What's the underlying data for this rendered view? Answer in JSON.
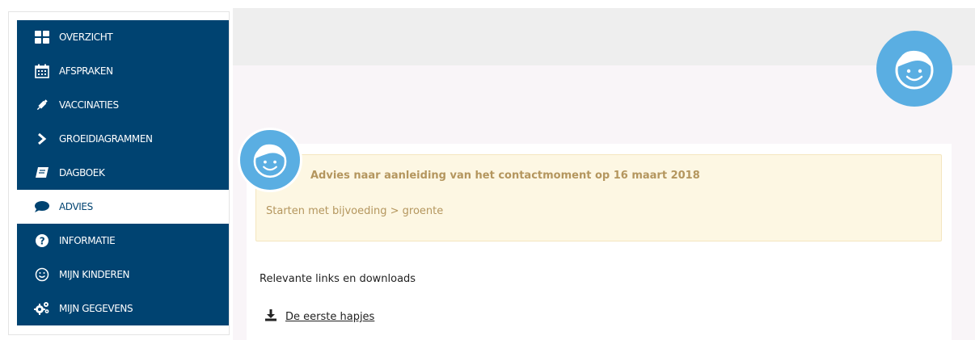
{
  "sidebar": {
    "items": [
      {
        "label": "OVERZICHT",
        "icon": "dashboard-icon",
        "active": false
      },
      {
        "label": "AFSPRAKEN",
        "icon": "calendar-icon",
        "active": false
      },
      {
        "label": "VACCINATIES",
        "icon": "syringe-icon",
        "active": false
      },
      {
        "label": "GROEIDIAGRAMMEN",
        "icon": "chevron-right-icon",
        "active": false
      },
      {
        "label": "DAGBOEK",
        "icon": "book-icon",
        "active": false
      },
      {
        "label": "ADVIES",
        "icon": "speech-bubble-icon",
        "active": true
      },
      {
        "label": "INFORMATIE",
        "icon": "question-circle-icon",
        "active": false
      },
      {
        "label": "MIJN KINDEREN",
        "icon": "smiley-icon",
        "active": false
      },
      {
        "label": "MIJN GEGEVENS",
        "icon": "gears-icon",
        "active": false
      }
    ]
  },
  "advice": {
    "title": "Advies naar aanleiding van het contactmoment op 16 maart 2018",
    "item": "Starten met bijvoeding > groente"
  },
  "links": {
    "heading": "Relevante links en downloads",
    "download_label": "De eerste hapjes"
  },
  "colors": {
    "nav_bg": "#004371",
    "avatar_blue": "#5aaee2",
    "advice_text": "#b4965e",
    "advice_bg": "#fdf7e3"
  }
}
